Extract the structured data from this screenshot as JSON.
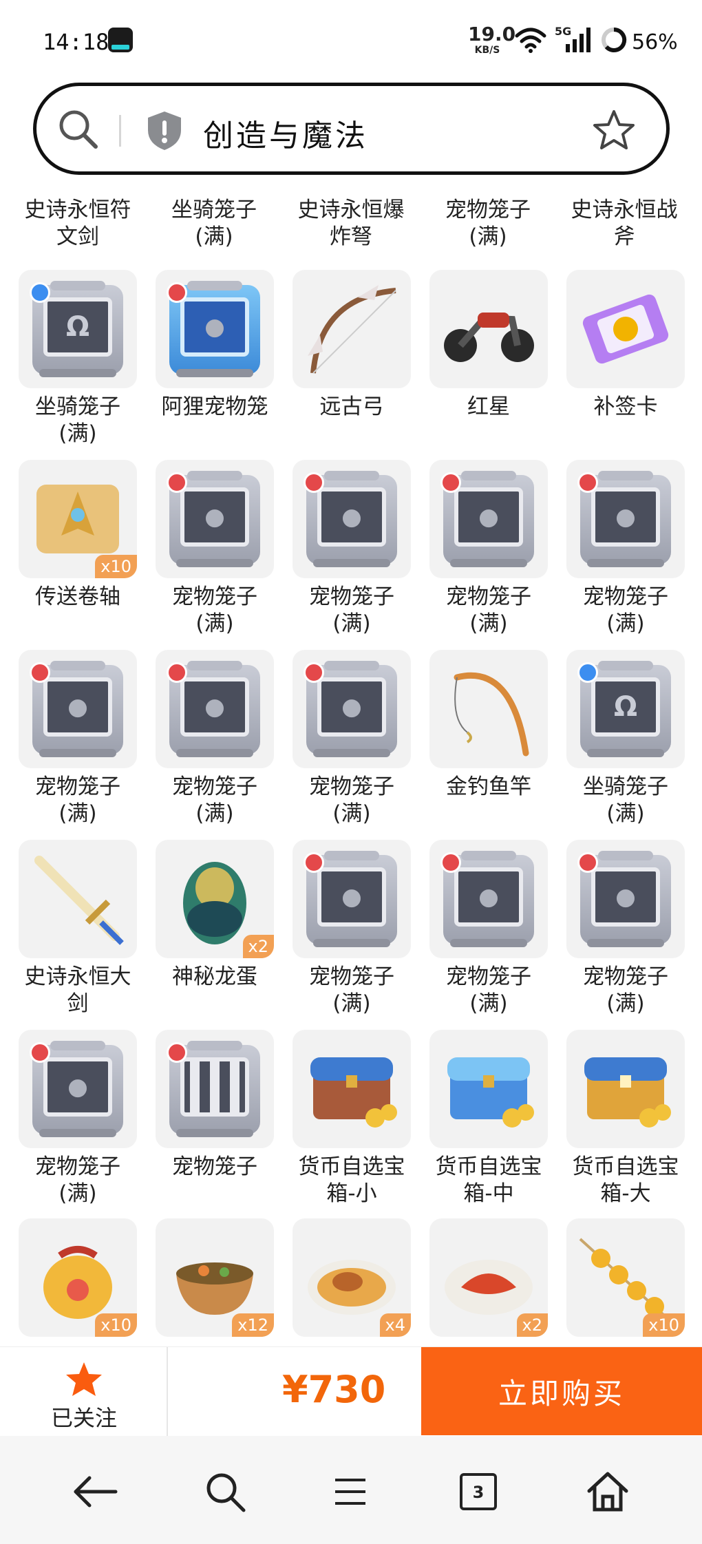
{
  "status_bar": {
    "time": "14:18",
    "net_speed_value": "19.0",
    "net_speed_unit": "KB/S",
    "network": "5G",
    "battery": "56%"
  },
  "search": {
    "query": "创造与魔法",
    "icons": [
      "search-icon",
      "shield-icon",
      "star-icon"
    ]
  },
  "grid": {
    "partial_labels_top": [
      "史诗永恒符文剑",
      "坐骑笼子(满)",
      "史诗永恒爆炸弩",
      "宠物笼子(满)",
      "史诗永恒战斧"
    ],
    "rows": [
      [
        {
          "label": "坐骑笼子(满)",
          "icon": "mount-cage"
        },
        {
          "label": "阿狸宠物笼",
          "icon": "blue-pet-cage"
        },
        {
          "label": "远古弓",
          "icon": "ancient-bow"
        },
        {
          "label": "红星",
          "icon": "red-star-motorcycle"
        },
        {
          "label": "补签卡",
          "icon": "makeup-sign-card"
        }
      ],
      [
        {
          "label": "传送卷轴",
          "icon": "teleport-scroll",
          "qty": "x10"
        },
        {
          "label": "宠物笼子(满)",
          "icon": "pet-cage"
        },
        {
          "label": "宠物笼子(满)",
          "icon": "pet-cage"
        },
        {
          "label": "宠物笼子(满)",
          "icon": "pet-cage"
        },
        {
          "label": "宠物笼子(满)",
          "icon": "pet-cage"
        }
      ],
      [
        {
          "label": "宠物笼子(满)",
          "icon": "pet-cage"
        },
        {
          "label": "宠物笼子(满)",
          "icon": "pet-cage"
        },
        {
          "label": "宠物笼子(满)",
          "icon": "pet-cage"
        },
        {
          "label": "金钓鱼竿",
          "icon": "golden-fishing-rod"
        },
        {
          "label": "坐骑笼子(满)",
          "icon": "mount-cage"
        }
      ],
      [
        {
          "label": "史诗永恒大剑",
          "icon": "epic-greatsword"
        },
        {
          "label": "神秘龙蛋",
          "icon": "mystery-dragon-egg",
          "qty": "x2"
        },
        {
          "label": "宠物笼子(满)",
          "icon": "pet-cage"
        },
        {
          "label": "宠物笼子(满)",
          "icon": "pet-cage"
        },
        {
          "label": "宠物笼子(满)",
          "icon": "pet-cage"
        }
      ],
      [
        {
          "label": "宠物笼子(满)",
          "icon": "pet-cage"
        },
        {
          "label": "宠物笼子",
          "icon": "empty-pet-cage"
        },
        {
          "label": "货币自选宝箱-小",
          "icon": "treasure-chest-small"
        },
        {
          "label": "货币自选宝箱-中",
          "icon": "treasure-chest-medium"
        },
        {
          "label": "货币自选宝箱-大",
          "icon": "treasure-chest-large"
        }
      ],
      [
        {
          "label": "",
          "icon": "pet-exp-bag",
          "qty": "x10"
        },
        {
          "label": "",
          "icon": "soup-bowl",
          "qty": "x12"
        },
        {
          "label": "",
          "icon": "roast-drumstick-plate",
          "qty": "x4"
        },
        {
          "label": "",
          "icon": "crab-dish",
          "qty": "x2"
        },
        {
          "label": "",
          "icon": "skewer-balls",
          "qty": "x10"
        }
      ]
    ]
  },
  "action_bar": {
    "follow_label": "已关注",
    "price": "¥730",
    "buy_label": "立即购买"
  },
  "nav_bar": {
    "icons": [
      "back-arrow-icon",
      "search-icon",
      "menu-icon",
      "tabs-icon",
      "home-icon"
    ],
    "tabs_count": "3"
  },
  "colors": {
    "accent": "#fa6314",
    "price": "#f2660a",
    "qty_badge": "#f2a054"
  }
}
